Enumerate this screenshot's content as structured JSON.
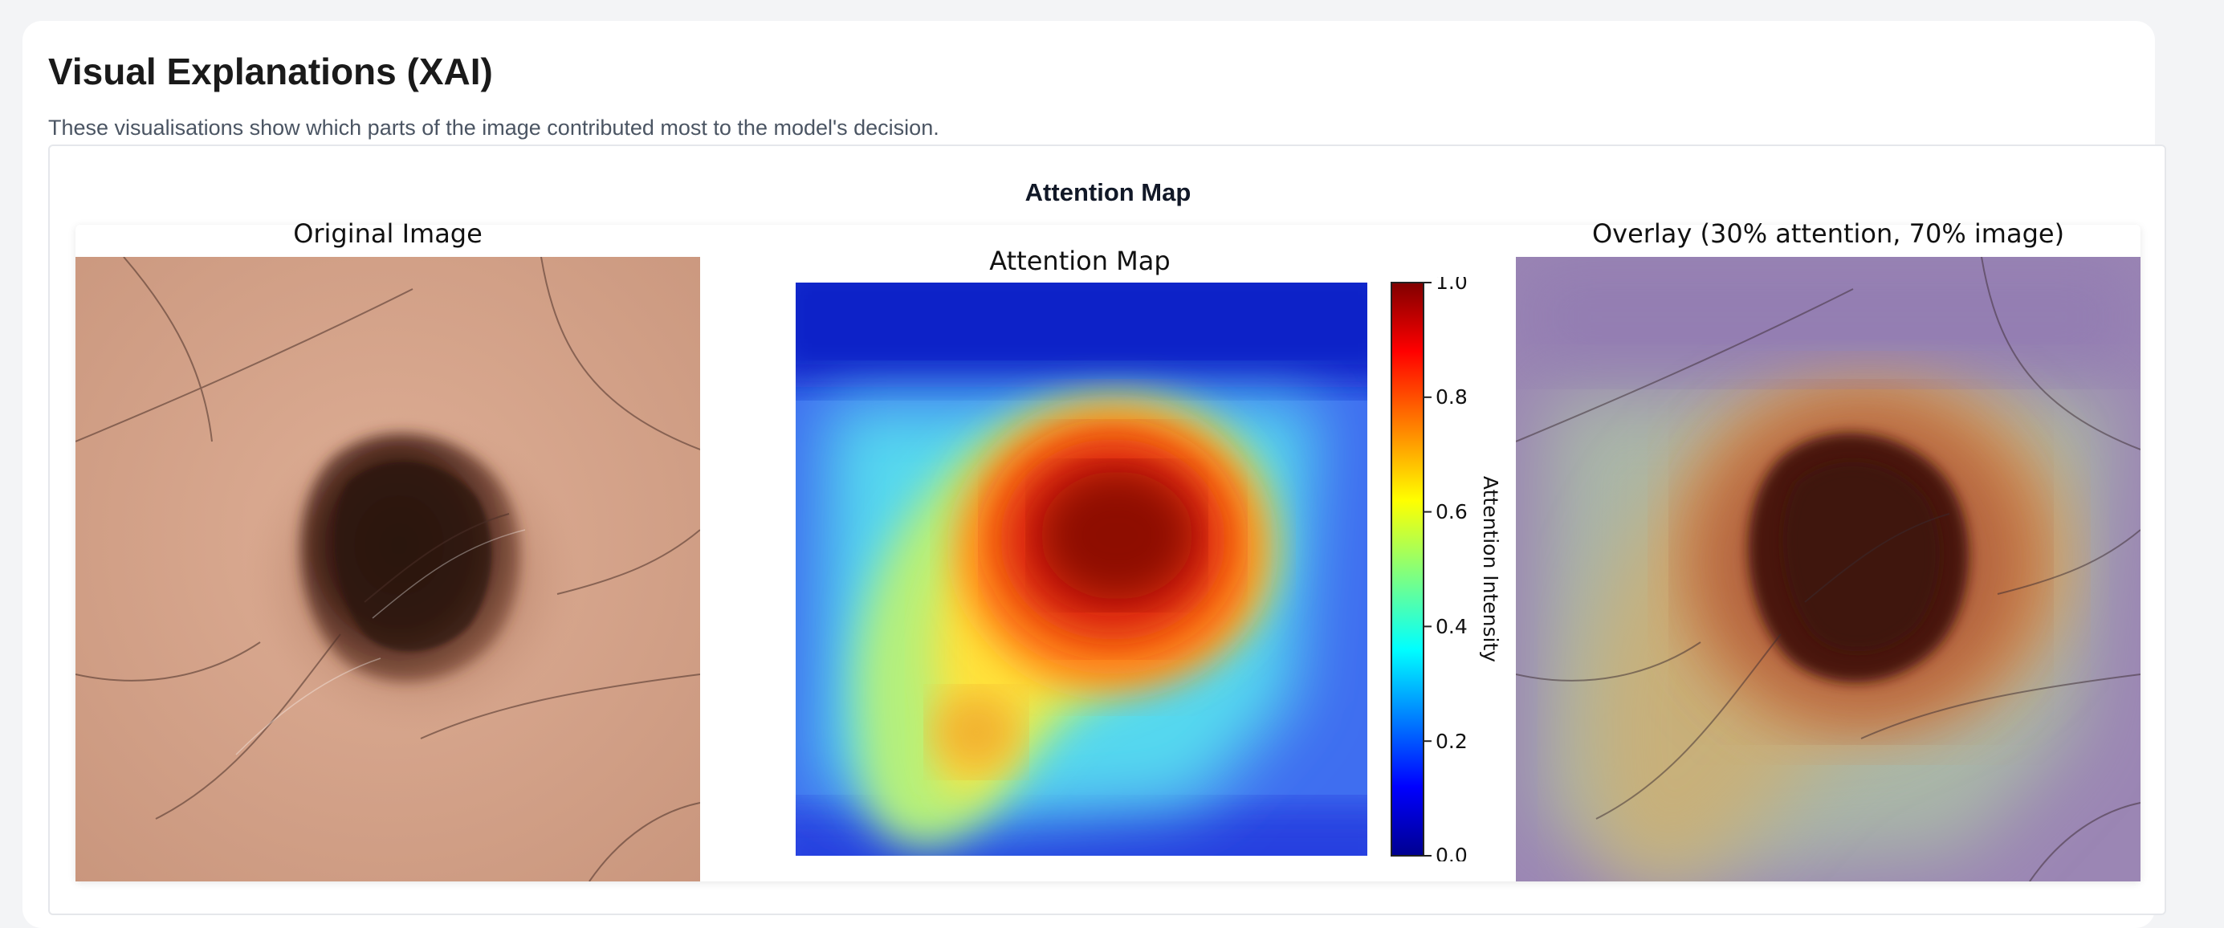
{
  "header": {
    "title": "Visual Explanations (XAI)",
    "description": "These visualisations show which parts of the image contributed most to the model's decision."
  },
  "panel": {
    "title": "Attention Map"
  },
  "figure": {
    "original_label": "Original Image",
    "attention_label": "Attention Map",
    "overlay_label": "Overlay (30% attention, 70% image)",
    "colorbar": {
      "label": "Attention Intensity",
      "ticks": [
        "0.0",
        "0.2",
        "0.4",
        "0.6",
        "0.8",
        "1.0"
      ],
      "colormap": "jet",
      "range": [
        0.0,
        1.0
      ]
    }
  },
  "colors": {
    "skin": "#d8a78e",
    "lesion": "#3a1a12",
    "attention_peak": "#8b0000",
    "attention_low": "#00008b"
  }
}
